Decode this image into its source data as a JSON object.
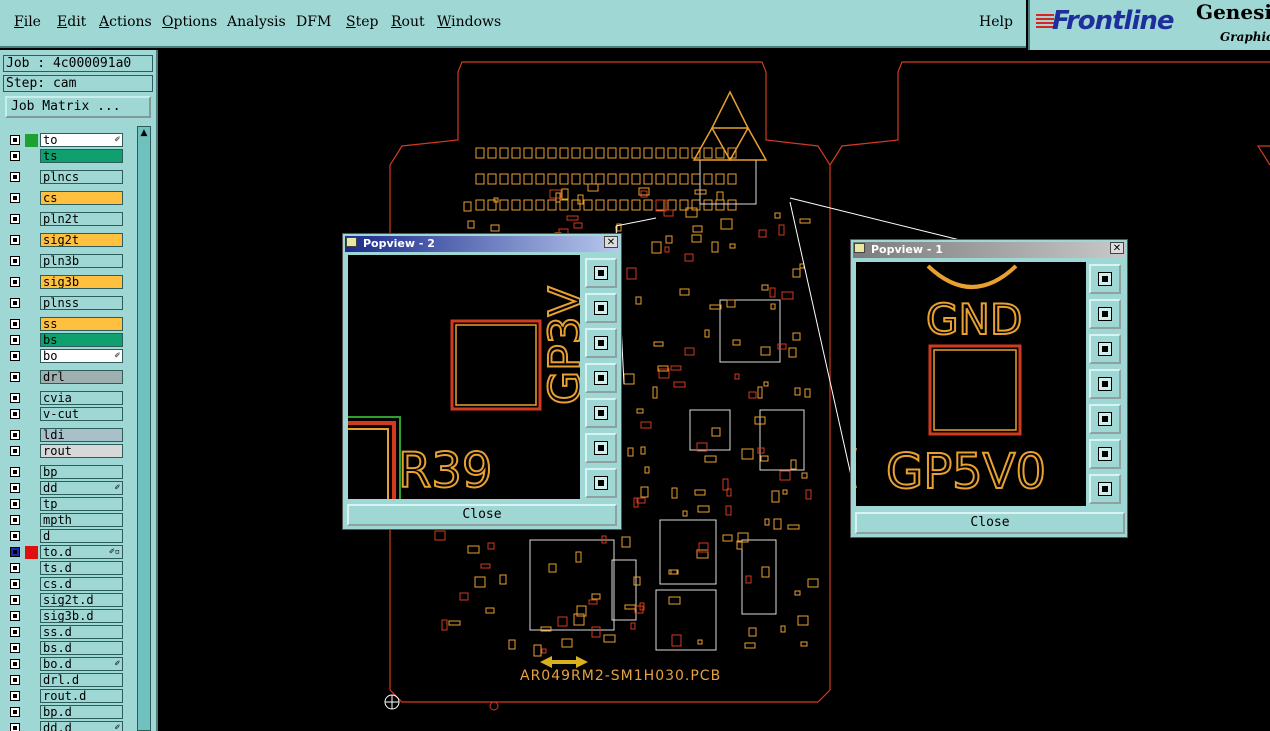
{
  "menu": {
    "items": [
      {
        "label": "File",
        "underline": "F",
        "rest": "ile"
      },
      {
        "label": "Edit",
        "underline": "E",
        "rest": "dit"
      },
      {
        "label": "Actions",
        "underline": "A",
        "rest": "ctions"
      },
      {
        "label": "Options",
        "underline": "O",
        "rest": "ptions"
      },
      {
        "label": "Analysis",
        "underline": "",
        "rest": "Analysis"
      },
      {
        "label": "DFM",
        "underline": "",
        "rest": "DFM"
      },
      {
        "label": "Step",
        "underline": "S",
        "rest": "tep"
      },
      {
        "label": "Rout",
        "underline": "R",
        "rest": "out"
      },
      {
        "label": "Windows",
        "underline": "W",
        "rest": "indows"
      }
    ],
    "help": "Help"
  },
  "logo": {
    "brand": "Frontline",
    "product": "Genesis",
    "tagline": "Graphic"
  },
  "job": {
    "job_text": "Job : 4c000091a0",
    "step_text": "Step: cam",
    "matrix_button": "Job Matrix ..."
  },
  "layers": [
    {
      "name": "to",
      "color": "#ffffff",
      "swatch": "#1fa032",
      "flag": "✐"
    },
    {
      "name": "ts",
      "color": "#10a070",
      "swatch": "",
      "flag": ""
    },
    {
      "name": "plncs",
      "color": "#9fd7d4",
      "swatch": "",
      "flag": ""
    },
    {
      "name": "cs",
      "color": "#ffc040",
      "swatch": "",
      "flag": ""
    },
    {
      "name": "pln2t",
      "color": "#9fd7d4",
      "swatch": "",
      "flag": ""
    },
    {
      "name": "sig2t",
      "color": "#ffc040",
      "swatch": "",
      "flag": ""
    },
    {
      "name": "pln3b",
      "color": "#9fd7d4",
      "swatch": "",
      "flag": ""
    },
    {
      "name": "sig3b",
      "color": "#ffc040",
      "swatch": "",
      "flag": ""
    },
    {
      "name": "plnss",
      "color": "#9fd7d4",
      "swatch": "",
      "flag": ""
    },
    {
      "name": "ss",
      "color": "#ffc040",
      "swatch": "",
      "flag": ""
    },
    {
      "name": "bs",
      "color": "#10a070",
      "swatch": "",
      "flag": ""
    },
    {
      "name": "bo",
      "color": "#ffffff",
      "swatch": "",
      "flag": "✐"
    },
    {
      "name": "drl",
      "color": "#a0b0b0",
      "swatch": "",
      "flag": ""
    },
    {
      "name": "cvia",
      "color": "#9fd7d4",
      "swatch": "",
      "flag": ""
    },
    {
      "name": "v-cut",
      "color": "#9fd7d4",
      "swatch": "",
      "flag": ""
    },
    {
      "name": "ldi",
      "color": "#a8c0c8",
      "swatch": "",
      "flag": ""
    },
    {
      "name": "rout",
      "color": "#d8d8d8",
      "swatch": "",
      "flag": ""
    },
    {
      "name": "bp",
      "color": "#9fd7d4",
      "swatch": "",
      "flag": ""
    },
    {
      "name": "dd",
      "color": "#9fd7d4",
      "swatch": "",
      "flag": "✐"
    },
    {
      "name": "tp",
      "color": "#9fd7d4",
      "swatch": "",
      "flag": ""
    },
    {
      "name": "mpth",
      "color": "#9fd7d4",
      "swatch": "",
      "flag": ""
    },
    {
      "name": "d",
      "color": "#9fd7d4",
      "swatch": "",
      "flag": ""
    },
    {
      "name": "to.d",
      "color": "#9fd7d4",
      "swatch": "#e01010",
      "flag": "✐▫"
    },
    {
      "name": "ts.d",
      "color": "#9fd7d4",
      "swatch": "",
      "flag": ""
    },
    {
      "name": "cs.d",
      "color": "#9fd7d4",
      "swatch": "",
      "flag": ""
    },
    {
      "name": "sig2t.d",
      "color": "#9fd7d4",
      "swatch": "",
      "flag": ""
    },
    {
      "name": "sig3b.d",
      "color": "#9fd7d4",
      "swatch": "",
      "flag": ""
    },
    {
      "name": "ss.d",
      "color": "#9fd7d4",
      "swatch": "",
      "flag": ""
    },
    {
      "name": "bs.d",
      "color": "#9fd7d4",
      "swatch": "",
      "flag": ""
    },
    {
      "name": "bo.d",
      "color": "#9fd7d4",
      "swatch": "",
      "flag": "✐"
    },
    {
      "name": "drl.d",
      "color": "#9fd7d4",
      "swatch": "",
      "flag": ""
    },
    {
      "name": "rout.d",
      "color": "#9fd7d4",
      "swatch": "",
      "flag": ""
    },
    {
      "name": "bp.d",
      "color": "#9fd7d4",
      "swatch": "",
      "flag": ""
    },
    {
      "name": "dd.d",
      "color": "#9fd7d4",
      "swatch": "",
      "flag": "✐"
    }
  ],
  "board": {
    "part_number": "AR049RM2-SM1H030.PCB"
  },
  "popview2": {
    "title": "Popview - 2",
    "label_a": "R39",
    "label_b": "GP3V",
    "close": "Close"
  },
  "popview1": {
    "title": "Popview - 1",
    "label_a": "GND",
    "label_b": "GP5V0",
    "close": "Close"
  },
  "colors": {
    "silk": "#e8a030",
    "copper": "#d23a20",
    "panel": "#9fd7d4"
  }
}
